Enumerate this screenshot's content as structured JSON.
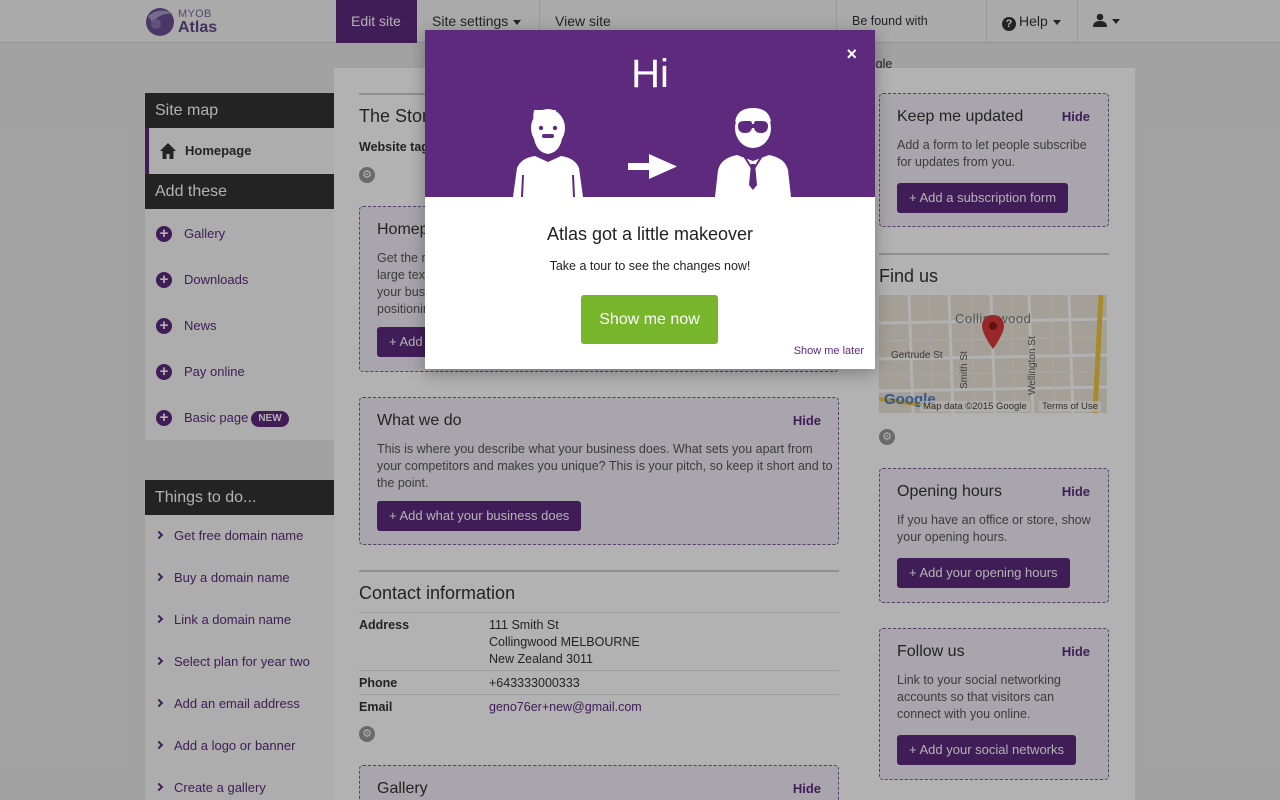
{
  "topbar": {
    "logo_line1": "MYOB",
    "logo_line2": "Atlas",
    "tabs": [
      {
        "label": "Edit site"
      },
      {
        "label": "Site settings"
      },
      {
        "label": "View site"
      }
    ],
    "google_label": "Be found with Google",
    "help_label": "Help",
    "user_icon": "user-icon"
  },
  "sidebar": {
    "sitemap_heading": "Site map",
    "homepage_label": "Homepage",
    "add_heading": "Add these",
    "add_items": [
      {
        "label": "Gallery"
      },
      {
        "label": "Downloads"
      },
      {
        "label": "News"
      },
      {
        "label": "Pay online"
      },
      {
        "label": "Basic page",
        "badge": "NEW"
      }
    ],
    "todo_heading": "Things to do...",
    "todo_items": [
      {
        "label": "Get free domain name"
      },
      {
        "label": "Buy a domain name"
      },
      {
        "label": "Link a domain name"
      },
      {
        "label": "Select plan for year two"
      },
      {
        "label": "Add an email address"
      },
      {
        "label": "Add a logo or banner"
      },
      {
        "label": "Create a gallery"
      }
    ]
  },
  "main": {
    "story_title": "The Story",
    "website_tagline_label": "Website tagline",
    "homepage_box": {
      "title": "Homepage",
      "lines": [
        "Get the most",
        "large text",
        "your busi",
        "positionin"
      ],
      "button": "+ Add"
    },
    "what_we_do": {
      "title": "What we do",
      "hide": "Hide",
      "text_lines": [
        "This is where you describe what your business does. What sets you apart from",
        "your competitors and makes you unique? This is your pitch, so keep it short and to",
        "the point."
      ],
      "button": "+ Add what your business does"
    },
    "contact": {
      "title": "Contact information",
      "address_label": "Address",
      "address_lines": [
        "111 Smith St",
        "Collingwood MELBOURNE",
        "New Zealand 3011"
      ],
      "phone_label": "Phone",
      "phone": "+643333000333",
      "email_label": "Email",
      "email": "geno76er+new@gmail.com"
    },
    "gallery": {
      "title": "Gallery",
      "hide": "Hide"
    }
  },
  "right": {
    "keep_updated": {
      "title": "Keep me updated",
      "hide": "Hide",
      "text_lines": [
        "Add a form to let people subscribe",
        "for updates from you."
      ],
      "button": "+ Add a subscription form"
    },
    "find_us": {
      "title": "Find us",
      "map_suburb": "Collingwood",
      "map_streets": [
        "Gertrude St",
        "Smith St",
        "Wellington St"
      ],
      "map_brand": "Google",
      "map_credit": "Map data ©2015 Google",
      "map_terms": "Terms of Use"
    },
    "opening_hours": {
      "title": "Opening hours",
      "hide": "Hide",
      "text_lines": [
        "If you have an office or store, show",
        "your opening hours."
      ],
      "button": "+ Add your opening hours"
    },
    "follow_us": {
      "title": "Follow us",
      "hide": "Hide",
      "text_lines": [
        "Link to your social networking",
        "accounts so that visitors can",
        "connect with you online."
      ],
      "button": "+ Add your social networks"
    }
  },
  "modal": {
    "greeting": "Hi",
    "close_symbol": "×",
    "heading": "Atlas got a little makeover",
    "subtext": "Take a tour to see the changes now!",
    "primary_button": "Show me now",
    "later_link": "Show me later"
  },
  "colors": {
    "brand_purple": "#5d2a7e",
    "cta_green": "#77b52b"
  }
}
